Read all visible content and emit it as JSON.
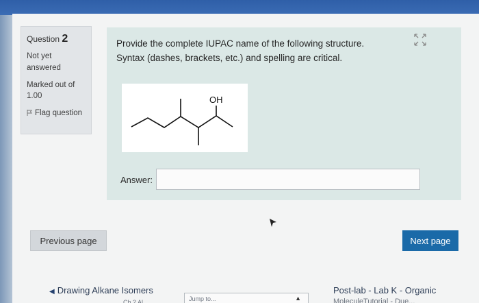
{
  "question_info": {
    "label": "Question",
    "number": "2",
    "state": "Not yet answered",
    "marks": "Marked out of 1.00",
    "flag_label": "Flag question"
  },
  "question": {
    "text": "Provide the complete IUPAC name of the following structure. Syntax (dashes, brackets, etc.) and spelling are critical.",
    "structure_label": "OH",
    "answer_label": "Answer:",
    "answer_value": ""
  },
  "nav": {
    "previous_label": "Previous page",
    "next_label": "Next page"
  },
  "footer": {
    "prev_activity": "Drawing Alkane Isomers",
    "prev_activity_sub": "Ch 2 Al...",
    "jump_label": "Jump to...",
    "next_activity": "Post-lab - Lab K - Organic",
    "next_activity_sub": "MoleculeTutorial - Due..."
  }
}
